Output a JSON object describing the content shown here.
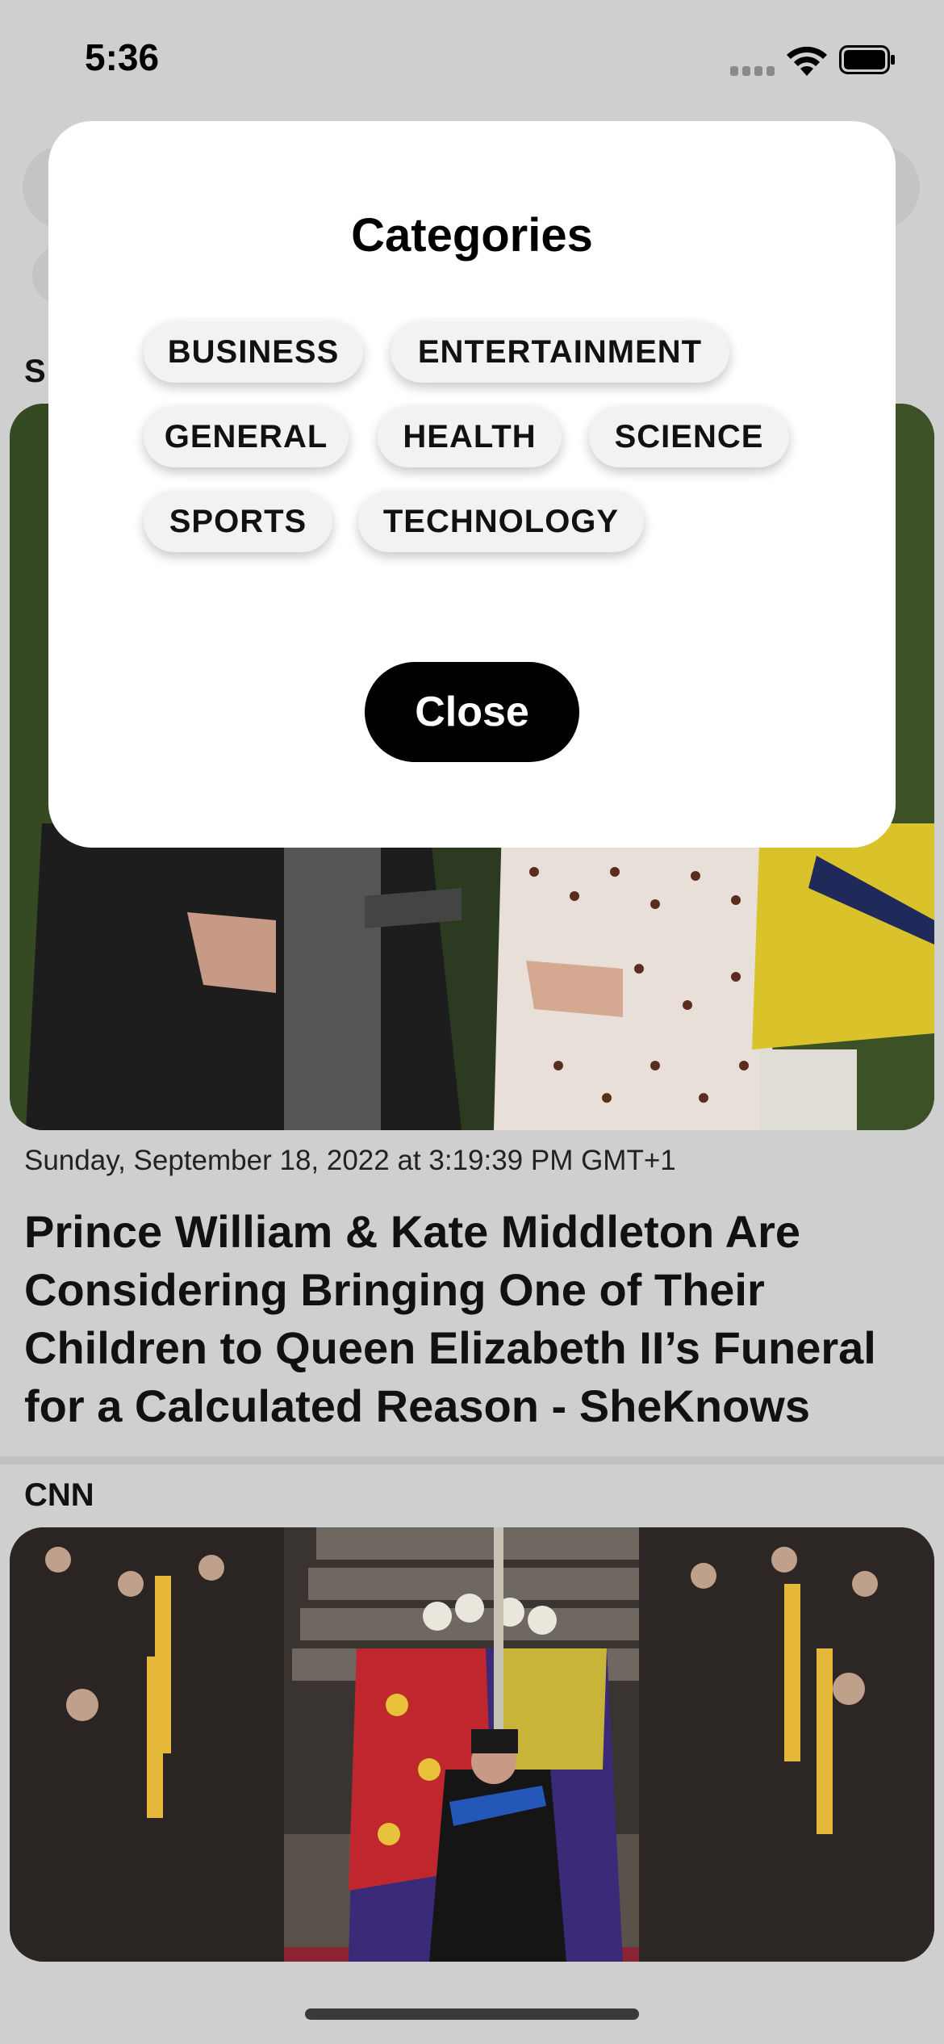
{
  "status_bar": {
    "time": "5:36"
  },
  "background": {
    "section_initial": "S"
  },
  "modal": {
    "title": "Categories",
    "categories": [
      "BUSINESS",
      "ENTERTAINMENT",
      "GENERAL",
      "HEALTH",
      "SCIENCE",
      "SPORTS",
      "TECHNOLOGY"
    ],
    "close_label": "Close"
  },
  "articles": [
    {
      "date": "Sunday, September 18, 2022 at 3:19:39 PM GMT+1",
      "title": "Prince William & Kate Middleton Are Considering Bringing One of Their Children to Queen Elizabeth II’s Funeral for a Calculated Reason - SheKnows"
    },
    {
      "source": "CNN"
    }
  ],
  "colors": {
    "dim_background": "#cfcfcf",
    "modal": "#ffffff",
    "close_button": "#000000",
    "chip": "#f2f2f2"
  }
}
